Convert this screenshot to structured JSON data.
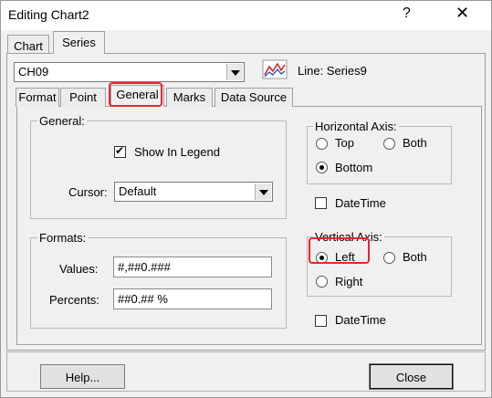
{
  "window": {
    "title": "Editing Chart2",
    "help_glyph": "?",
    "close_glyph": "✕"
  },
  "outer_tabs": [
    "Chart",
    "Series"
  ],
  "series_combo": {
    "value": "CH09"
  },
  "series_info": {
    "label": "Line: Series9"
  },
  "inner_tabs": [
    "Format",
    "Point",
    "General",
    "Marks",
    "Data Source"
  ],
  "general_group": {
    "title": "General:",
    "show_in_legend": {
      "label": "Show In Legend",
      "checked": true
    },
    "cursor": {
      "label": "Cursor:",
      "value": "Default"
    }
  },
  "formats_group": {
    "title": "Formats:",
    "values": {
      "label": "Values:",
      "value": "#,##0.###"
    },
    "percents": {
      "label": "Percents:",
      "value": "##0.## %"
    }
  },
  "horizontal_axis": {
    "title": "Horizontal Axis:",
    "top": "Top",
    "both": "Both",
    "bottom": "Bottom",
    "selected": "Bottom"
  },
  "horizontal_datetime": {
    "label": "DateTime",
    "checked": false
  },
  "vertical_axis": {
    "title": "Vertical Axis:",
    "left": "Left",
    "both": "Both",
    "right": "Right",
    "selected": "Left"
  },
  "vertical_datetime": {
    "label": "DateTime",
    "checked": false
  },
  "buttons": {
    "help": "Help...",
    "close": "Close"
  },
  "colors": {
    "highlight": "#e8262c"
  }
}
